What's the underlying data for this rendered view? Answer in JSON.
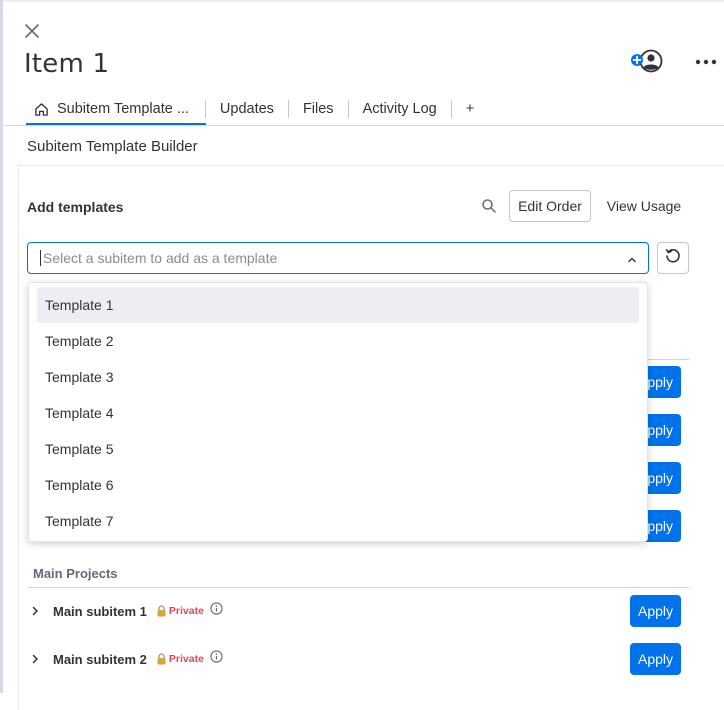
{
  "item_title": "Item 1",
  "tabs": [
    {
      "label": "Subitem Template ..."
    },
    {
      "label": "Updates"
    },
    {
      "label": "Files"
    },
    {
      "label": "Activity Log"
    },
    {
      "label": "+"
    }
  ],
  "section_title": "Subitem Template Builder",
  "add_templates": {
    "heading": "Add templates",
    "edit_order_label": "Edit Order",
    "view_usage_label": "View Usage",
    "select_placeholder": "Select a subitem to add as a template"
  },
  "dropdown_options": [
    {
      "label": "Template 1"
    },
    {
      "label": "Template 2"
    },
    {
      "label": "Template 3"
    },
    {
      "label": "Template 4"
    },
    {
      "label": "Template 5"
    },
    {
      "label": "Template 6"
    },
    {
      "label": "Template 7"
    }
  ],
  "background_apply_label": "Apply",
  "group": {
    "label": "Main Projects",
    "rows": [
      {
        "name": "Main subitem 1",
        "privacy": "Private",
        "apply_label": "Apply"
      },
      {
        "name": "Main subitem 2",
        "privacy": "Private",
        "apply_label": "Apply"
      }
    ]
  },
  "colors": {
    "accent": "#0073ea",
    "private": "#e2445c"
  }
}
